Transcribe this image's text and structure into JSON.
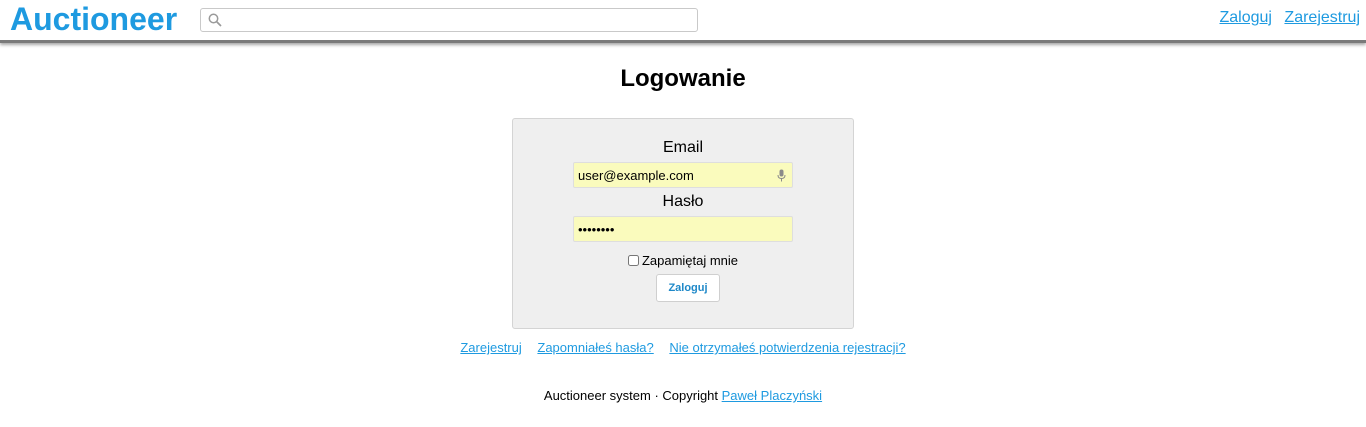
{
  "header": {
    "brand": "Auctioneer",
    "search": {
      "value": "",
      "placeholder": ""
    },
    "nav": {
      "login": "Zaloguj",
      "register": "Zarejestruj"
    }
  },
  "login": {
    "title": "Logowanie",
    "email_label": "Email",
    "email_value": "user@example.com",
    "password_label": "Hasło",
    "password_value": "password",
    "remember_label": "Zapamiętaj mnie",
    "remember_checked": false,
    "submit_label": "Zaloguj"
  },
  "links": {
    "register": "Zarejestruj",
    "forgot": "Zapomniałeś hasła?",
    "no_confirmation": "Nie otrzymałeś potwierdzenia rejestracji?"
  },
  "footer": {
    "text": "Auctioneer system · Copyright ",
    "author": "Paweł Placzyński"
  },
  "colors": {
    "accent": "#1e9ae0",
    "autofill": "#fafbbd",
    "panel": "#efefef"
  }
}
